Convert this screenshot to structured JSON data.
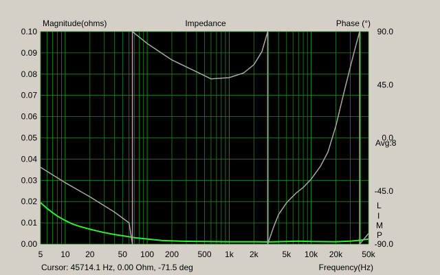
{
  "window": {
    "cursor_readout": "Cursor: 45714.1 Hz, 0.00 Ohm, -71.5 deg",
    "avg_label": "Avg:8",
    "limp_letters": [
      "L",
      "I",
      "M",
      "P"
    ]
  },
  "colors": {
    "background": "#d4d0c8",
    "plot_background": "#000000",
    "grid": "#1f8a1f",
    "magnitude_series": "#33ee33",
    "phase_series": "#a8a8a8"
  },
  "chart_data": {
    "type": "line",
    "title": "Impedance",
    "ylabel": "Magnitude(ohms)",
    "y2label": "Phase (°)",
    "xlabel": "Frequency(Hz)",
    "x_scale": "log",
    "xlim": [
      5,
      50000
    ],
    "ylim": [
      0,
      0.1
    ],
    "y2lim": [
      -90,
      90
    ],
    "grid": true,
    "x_tick_values": [
      5,
      10,
      20,
      50,
      100,
      200,
      500,
      1000,
      2000,
      5000,
      10000,
      20000,
      50000
    ],
    "x_tick_labels": [
      "5",
      "10",
      "20",
      "50",
      "100",
      "200",
      "500",
      "1k",
      "2k",
      "5k",
      "10k",
      "20k",
      "50k"
    ],
    "y_tick_values": [
      0,
      0.01,
      0.02,
      0.03,
      0.04,
      0.05,
      0.06,
      0.07,
      0.08,
      0.09,
      0.1
    ],
    "y_tick_labels": [
      "0.00",
      "0.01",
      "0.02",
      "0.03",
      "0.04",
      "0.05",
      "0.06",
      "0.07",
      "0.08",
      "0.09",
      "0.10"
    ],
    "y2_tick_values": [
      90,
      45,
      0,
      -45,
      -90
    ],
    "y2_tick_labels": [
      "90.0",
      "45.0",
      "0.0",
      "-45.0",
      "-90.0"
    ],
    "series": [
      {
        "axis": "left",
        "color": "#33ee33",
        "x": [
          5,
          6,
          7,
          8,
          10,
          12,
          15,
          20,
          25,
          30,
          40,
          50,
          70,
          100,
          150,
          200,
          300,
          500,
          1000,
          2000,
          3000,
          5000,
          7000,
          10000,
          20000,
          30000,
          40000,
          50000
        ],
        "y": [
          0.0195,
          0.0168,
          0.0148,
          0.0132,
          0.0111,
          0.0096,
          0.0083,
          0.007,
          0.0061,
          0.0054,
          0.0045,
          0.0039,
          0.003,
          0.0024,
          0.0017,
          0.0015,
          0.0013,
          0.0012,
          0.0011,
          0.0011,
          0.001,
          0.0012,
          0.0014,
          0.0012,
          0.0011,
          0.0014,
          0.0018,
          0.0024
        ]
      },
      {
        "axis": "right",
        "color": "#a8a8a8",
        "x": [
          5,
          10,
          20,
          40,
          60,
          66,
          66.01,
          100,
          200,
          400,
          600,
          1000,
          1500,
          2000,
          2500,
          2950,
          2951,
          3500,
          4000,
          5000,
          6500,
          8000,
          10000,
          13000,
          16000,
          20000,
          25000,
          30000,
          35000,
          39000,
          39001,
          45000,
          50000
        ],
        "y": [
          -25,
          -38,
          -50,
          -63,
          -72,
          -90,
          90,
          80,
          66,
          56,
          50,
          51,
          55,
          62,
          73,
          90,
          -90,
          -75,
          -65,
          -55,
          -47,
          -42,
          -35,
          -24,
          -12,
          10,
          38,
          60,
          78,
          90,
          -90,
          -85,
          -81
        ]
      }
    ]
  }
}
